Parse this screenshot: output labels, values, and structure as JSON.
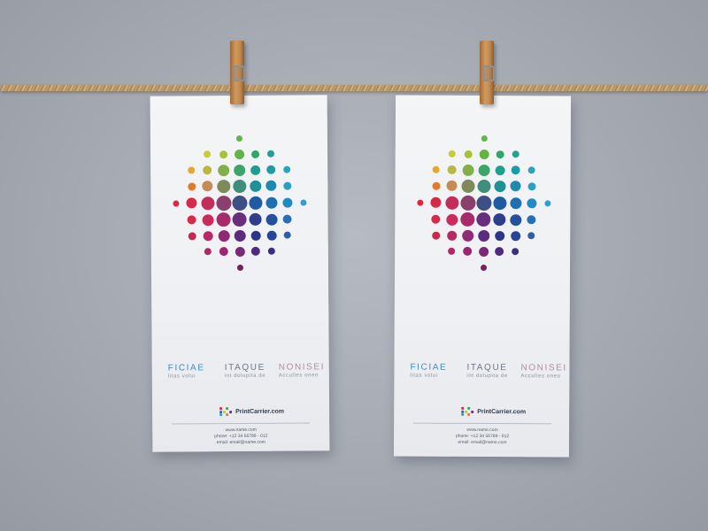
{
  "cards": [
    {
      "id": "left",
      "headings": [
        {
          "title": "FICIAE",
          "subtitle": "litas volui",
          "color": "#3a8bc0"
        },
        {
          "title": "ITAQUE",
          "subtitle": "int dolupita de",
          "color": "#6b7686"
        },
        {
          "title": "NONISEI",
          "subtitle": "Acculles oneo",
          "color": "#b08fa0"
        }
      ],
      "logo_text": "PrintCarrier.com",
      "contact": [
        "www.name.com",
        "phone: +12 34 56789 - 012",
        "email: email@name.com"
      ]
    },
    {
      "id": "right",
      "headings": [
        {
          "title": "FICIAE",
          "subtitle": "litas volui",
          "color": "#3a8bc0"
        },
        {
          "title": "ITAQUE",
          "subtitle": "int dolupita de",
          "color": "#6b7686"
        },
        {
          "title": "NONISEI",
          "subtitle": "Acculles oneo",
          "color": "#b08fa0"
        }
      ],
      "logo_text": "PrintCarrier.com",
      "contact": [
        "www.name.com",
        "phone: +12 34 56789 - 012",
        "email: email@name.com"
      ]
    }
  ]
}
